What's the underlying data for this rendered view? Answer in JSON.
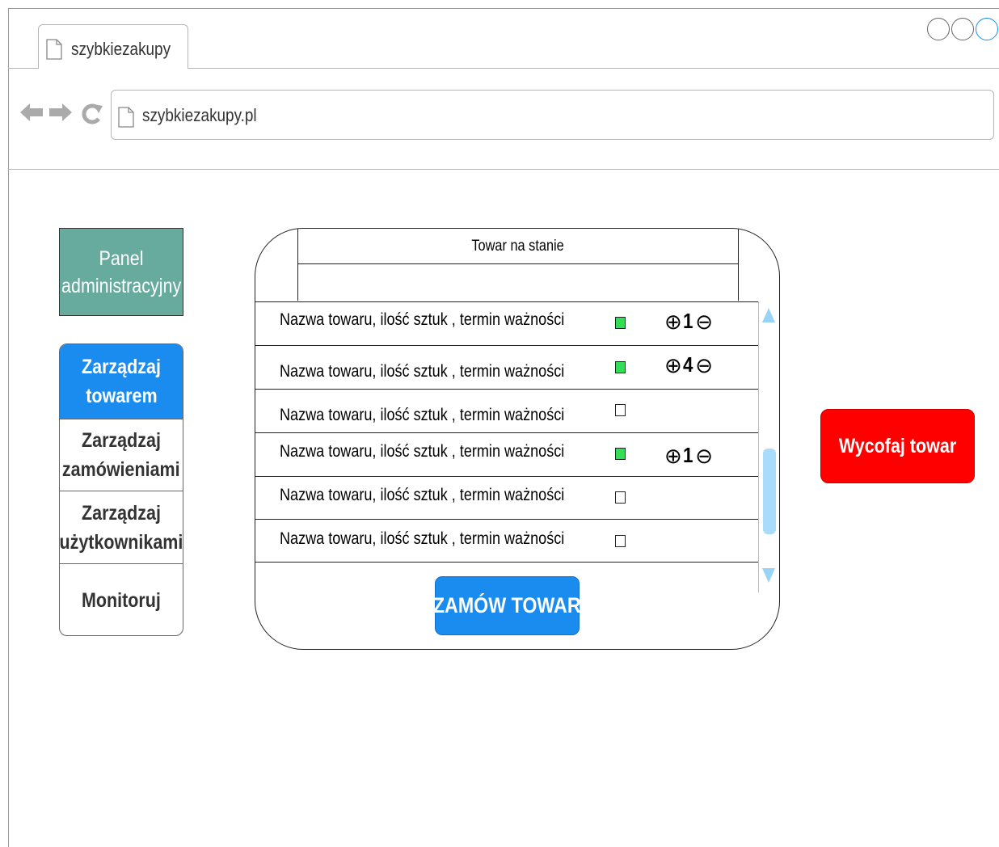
{
  "browser": {
    "tab_title": "szybkiezakupy",
    "url": "szybkiezakupy.pl"
  },
  "sidebar": {
    "panel_title": [
      "Panel",
      "administracyjny"
    ],
    "items": [
      {
        "label_lines": [
          "Zarządzaj",
          "towarem"
        ],
        "active": true
      },
      {
        "label_lines": [
          "Zarządzaj",
          "zamówieniami"
        ],
        "active": false
      },
      {
        "label_lines": [
          "Zarządzaj",
          "użytkownikami"
        ],
        "active": false
      },
      {
        "label_lines": [
          "Monitoruj"
        ],
        "active": false
      }
    ]
  },
  "table": {
    "header": "Towar na stanie",
    "rows": [
      {
        "name": "Nazwa towaru, ilość sztuk , termin ważności",
        "checked": true,
        "quantity": "1"
      },
      {
        "name": "Nazwa towaru, ilość sztuk , termin ważności",
        "checked": true,
        "quantity": "4"
      },
      {
        "name": "Nazwa towaru, ilość sztuk , termin ważności",
        "checked": false,
        "quantity": null
      },
      {
        "name": "Nazwa towaru, ilość sztuk , termin ważności",
        "checked": true,
        "quantity": "1"
      },
      {
        "name": "Nazwa towaru, ilość sztuk , termin ważności",
        "checked": false,
        "quantity": null
      },
      {
        "name": "Nazwa towaru, ilość sztuk , termin ważności",
        "checked": false,
        "quantity": null
      }
    ],
    "order_button": "ZAMÓW TOWAR"
  },
  "actions": {
    "withdraw_button": "Wycofaj towar"
  },
  "colors": {
    "accent_blue": "#1a8cf0",
    "panel_green": "#67ab9f",
    "danger_red": "#ff0000",
    "checkbox_green": "#33dd55"
  }
}
